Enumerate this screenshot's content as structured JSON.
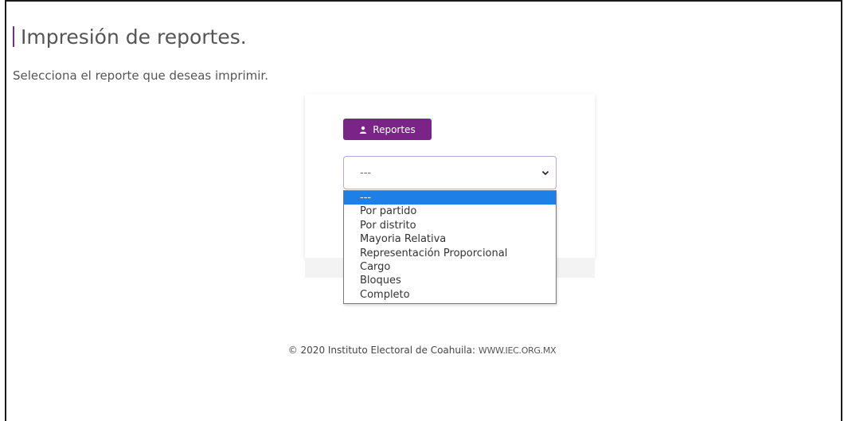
{
  "page": {
    "title": "Impresión de reportes.",
    "subtitle": "Selecciona el reporte que deseas imprimir."
  },
  "card": {
    "button_label": "Reportes",
    "select": {
      "value": "---",
      "options": [
        "---",
        "Por partido",
        "Por distrito",
        "Mayoria Relativa",
        "Representación Proporcional",
        "Cargo",
        "Bloques",
        "Completo"
      ],
      "selected_index": 0
    }
  },
  "footer": {
    "copyright": "© 2020 Instituto Electoral de Coahuila:",
    "url": "WWW.IEC.ORG.MX"
  },
  "colors": {
    "accent": "#7b2488",
    "highlight": "#1e7fe6"
  },
  "icons": {
    "button": "user-icon",
    "select": "chevron-down-icon"
  }
}
